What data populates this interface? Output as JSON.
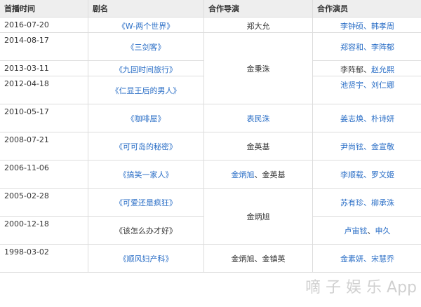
{
  "headers": [
    "首播时间",
    "剧名",
    "合作导演",
    "合作演员"
  ],
  "rows": [
    {
      "date": "2016-07-20",
      "title": "《W-两个世界》",
      "director": "郑大允",
      "cast_a": "李钟硕",
      "cast_sep": "、",
      "cast_b": "韩孝周"
    },
    {
      "date": "2014-08-17",
      "title": "《三剑客》",
      "director": "金秉洙",
      "cast_a": "郑容和",
      "cast_sep": "、",
      "cast_b": "李阵郁"
    },
    {
      "date": "2013-03-11",
      "title": "《九回时间旅行》",
      "cast_a": "李阵郁",
      "cast_sep": "、",
      "cast_b": "赵允熙"
    },
    {
      "date": "2012-04-18",
      "title": "《仁显王后的男人》",
      "cast_a": "池贤宇",
      "cast_sep": "、",
      "cast_b": "刘仁娜"
    },
    {
      "date": "2010-05-17",
      "title": "《咖啡屋》",
      "director": "表民洙",
      "cast_a": "姜志焕",
      "cast_sep": "、",
      "cast_b": "朴诗妍"
    },
    {
      "date": "2008-07-21",
      "title": "《可可岛的秘密》",
      "director": "金英基",
      "cast_a": "尹尚铉",
      "cast_sep": "、",
      "cast_b": "金宣敬"
    },
    {
      "date": "2006-11-06",
      "title": "《搞笑一家人》",
      "director_a": "金炳旭",
      "director_sep": "、",
      "director_b": "金英基",
      "cast_a": "李顺载",
      "cast_sep": "、",
      "cast_b": "罗文姬"
    },
    {
      "date": "2005-02-28",
      "title": "《可爱还是疯狂》",
      "director": "金炳旭",
      "cast_a": "苏有珍",
      "cast_sep": "、",
      "cast_b": "柳承洙"
    },
    {
      "date": "2000-12-18",
      "title": "《该怎么办才好》",
      "cast_a": "卢宙铉",
      "cast_sep": "、",
      "cast_b": "申久"
    },
    {
      "date": "1998-03-02",
      "title": "《顺风妇产科》",
      "director_a": "金炳旭",
      "director_sep": "、",
      "director_b": "金镇英",
      "cast_a": "金素妍",
      "cast_sep": "、",
      "cast_b": "宋慧乔"
    }
  ],
  "watermark": "嘀 子 娱 乐 App",
  "colors": {
    "link": "#2a6ec6",
    "header_bg": "#eeeeee",
    "border": "#dddddd",
    "text": "#333333"
  }
}
